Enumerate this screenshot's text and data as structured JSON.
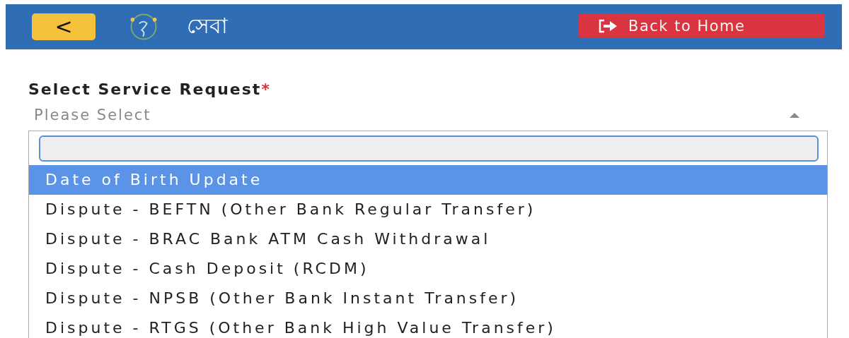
{
  "header": {
    "back_icon": "<",
    "brand": "সেবা",
    "home_button": "Back to Home"
  },
  "form": {
    "label": "Select Service Request",
    "required_mark": "*",
    "placeholder": "Please Select",
    "expanded": true,
    "dropdown": {
      "options": [
        {
          "label": "Date of Birth Update",
          "selected": true
        },
        {
          "label": "Dispute - BEFTN (Other Bank Regular Transfer)",
          "selected": false
        },
        {
          "label": "Dispute - BRAC Bank ATM Cash Withdrawal",
          "selected": false
        },
        {
          "label": "Dispute - Cash Deposit (RCDM)",
          "selected": false
        },
        {
          "label": "Dispute - NPSB (Other Bank Instant Transfer)",
          "selected": false
        },
        {
          "label": "Dispute - RTGS (Other Bank High Value Transfer)",
          "selected": false
        }
      ]
    }
  }
}
